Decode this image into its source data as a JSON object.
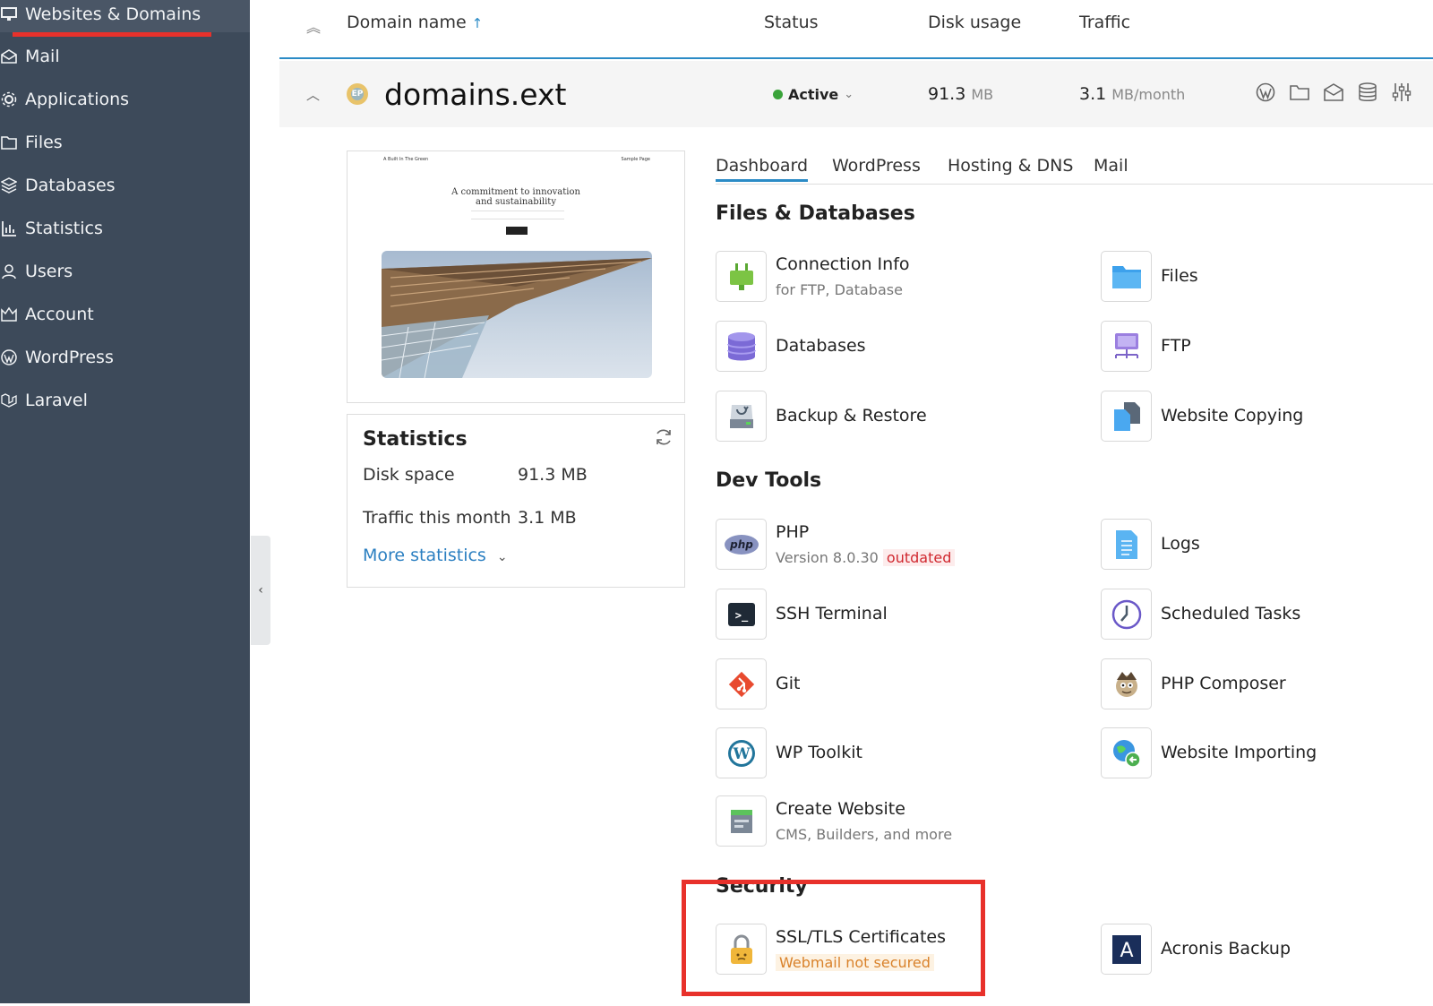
{
  "sidebar": {
    "items": [
      {
        "label": "Websites & Domains",
        "icon": "monitor-icon"
      },
      {
        "label": "Mail",
        "icon": "envelope-icon"
      },
      {
        "label": "Applications",
        "icon": "gear-icon"
      },
      {
        "label": "Files",
        "icon": "folder-icon"
      },
      {
        "label": "Databases",
        "icon": "database-icon"
      },
      {
        "label": "Statistics",
        "icon": "bar-chart-icon"
      },
      {
        "label": "Users",
        "icon": "user-icon"
      },
      {
        "label": "Account",
        "icon": "account-icon"
      },
      {
        "label": "WordPress",
        "icon": "wordpress-icon"
      },
      {
        "label": "Laravel",
        "icon": "laravel-icon"
      }
    ],
    "collapse_glyph": "‹"
  },
  "table_header": {
    "collapse_all_glyph": "︽",
    "domain_name": "Domain name",
    "sort_glyph": "↑",
    "status": "Status",
    "disk_usage": "Disk usage",
    "traffic": "Traffic"
  },
  "domain": {
    "collapse_glyph": "︿",
    "avatar_text": "EP",
    "name": "domains.ext",
    "status": "Active",
    "status_caret": "⌄",
    "disk_value": "91.3",
    "disk_unit": "MB",
    "traffic_value": "3.1",
    "traffic_unit": "MB/month",
    "row_icons": [
      "wordpress-icon",
      "folder-icon",
      "mail-icon",
      "database-icon",
      "sliders-icon"
    ]
  },
  "preview": {
    "top_left": "A Built In The Green",
    "top_right": "Sample Page",
    "headline_1": "A commitment to innovation",
    "headline_2": "and sustainability"
  },
  "statistics": {
    "title": "Statistics",
    "disk_label": "Disk space",
    "disk_value": "91.3 MB",
    "traffic_label": "Traffic this month",
    "traffic_value": "3.1 MB",
    "more_label": "More statistics",
    "more_caret": "⌄",
    "refresh_icon": "refresh-icon"
  },
  "tabs": [
    "Dashboard",
    "WordPress",
    "Hosting & DNS",
    "Mail"
  ],
  "sections": {
    "files_db": "Files & Databases",
    "dev_tools": "Dev Tools",
    "security": "Security"
  },
  "tools": {
    "connection_info": {
      "name": "Connection Info",
      "sub": "for FTP, Database",
      "icon": "plug-icon"
    },
    "files": {
      "name": "Files",
      "icon": "folder-icon"
    },
    "databases": {
      "name": "Databases",
      "icon": "database-icon"
    },
    "ftp": {
      "name": "FTP",
      "icon": "ftp-icon"
    },
    "backup": {
      "name": "Backup & Restore",
      "icon": "backup-icon"
    },
    "website_copying": {
      "name": "Website Copying",
      "icon": "copy-icon"
    },
    "php": {
      "name": "PHP",
      "sub": "Version 8.0.30",
      "badge": "outdated",
      "icon": "php-icon",
      "icon_text": "php"
    },
    "logs": {
      "name": "Logs",
      "icon": "log-file-icon"
    },
    "ssh": {
      "name": "SSH Terminal",
      "icon": "terminal-icon",
      "icon_text": ">_"
    },
    "scheduled": {
      "name": "Scheduled Tasks",
      "icon": "clock-icon"
    },
    "git": {
      "name": "Git",
      "icon": "git-icon"
    },
    "composer": {
      "name": "PHP Composer",
      "icon": "composer-icon"
    },
    "wp_toolkit": {
      "name": "WP Toolkit",
      "icon": "wordpress-icon",
      "icon_text": "W"
    },
    "website_importing": {
      "name": "Website Importing",
      "icon": "globe-import-icon"
    },
    "create_website": {
      "name": "Create Website",
      "sub": "CMS, Builders, and more",
      "icon": "create-website-icon"
    },
    "ssl": {
      "name": "SSL/TLS Certificates",
      "badge": "Webmail not secured",
      "icon": "lock-icon"
    },
    "acronis": {
      "name": "Acronis Backup",
      "icon": "acronis-icon",
      "icon_text": "A"
    }
  },
  "colors": {
    "sidebar_bg": "#3d4a5a",
    "accent_blue": "#2b8bc6",
    "highlight_red": "#e8312b",
    "status_green": "#3aa33a",
    "badge_red": "#d0282f",
    "badge_orange": "#d9822b"
  }
}
